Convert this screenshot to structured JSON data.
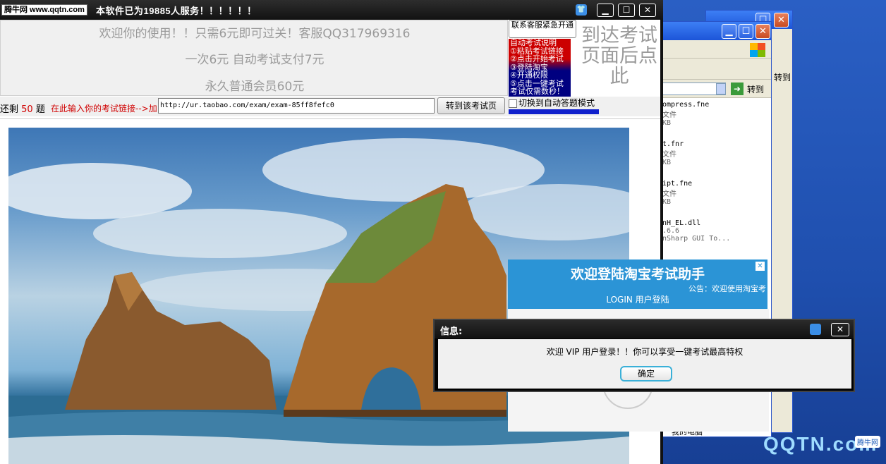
{
  "window": {
    "logo_text": "腾牛网 www.qqtn.com",
    "title": "本软件已为19885人服务！！！！！！",
    "min_label": "▁",
    "max_label": "☐",
    "close_label": "✕"
  },
  "banner": {
    "line1": "欢迎你的使用！！只需6元即可过关！客服QQ317969316",
    "line2": "一次6元  自动考试支付7元",
    "line3": "永久普通会员60元",
    "contact_button": "联系客服紧急开通",
    "auto_text": "自动考试说明\n①粘贴考试链接\n②点击开始考试\n③登陆淘宝\n④开通权限\n⑤点击一键考试\n考试仅需数秒！",
    "reach_text": "到达考试页面后点此"
  },
  "toolbar": {
    "remaining_prefix": "还剩",
    "remaining_count": "50",
    "remaining_suffix": "题",
    "hint": "在此输入你的考试链接-->加",
    "url_value": "http://ur.taobao.com/exam/exam-85ff8fefc0",
    "go_button": "转到该考试页",
    "switch_label": "切换到自动答题模式"
  },
  "login_panel": {
    "title": "欢迎登陆淘宝考试助手",
    "notice": "公告：欢迎使用淘宝考",
    "link": "LOGIN 用户登陆",
    "close_label": "✕"
  },
  "dialog": {
    "title": "信息:",
    "message": "欢迎  VIP 用户登录！！你可以享受一键考试最高特权",
    "ok_button": "确定",
    "close_label": "✕"
  },
  "bg_window": {
    "go_label": "转到",
    "go_label2": "转到",
    "files": [
      {
        "name": "ompress.fne",
        "type": "文件",
        "size": "KB"
      },
      {
        "name": "t.fnr",
        "type": "文件",
        "size": "KB"
      },
      {
        "name": "ipt.fne",
        "type": "文件",
        "size": "KB"
      },
      {
        "name": "nH_EL.dll",
        "type": ".6.6",
        "size": "nSharp GUI To..."
      }
    ],
    "my_computer": "我的电脑"
  },
  "watermark": {
    "logo": "QQTN.com",
    "tag": "腾牛网"
  }
}
